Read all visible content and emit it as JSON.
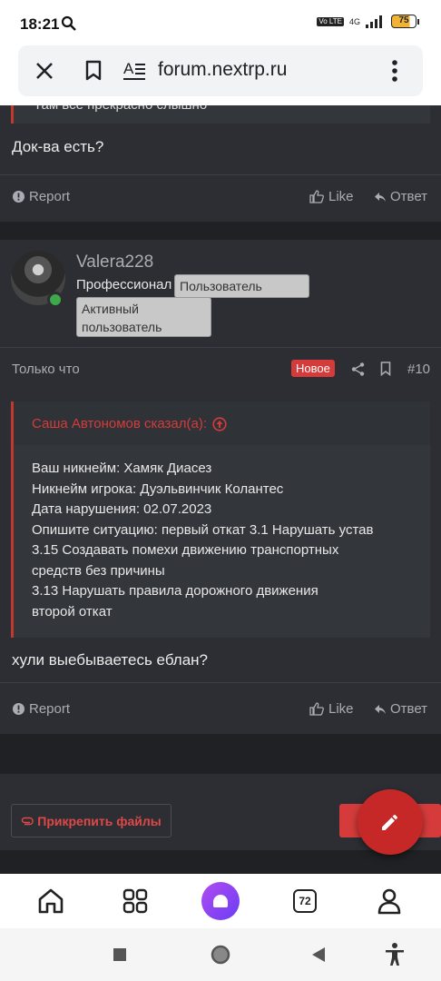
{
  "status": {
    "time": "18:21",
    "volte": "Vo LTE",
    "network": "4G",
    "battery": "75"
  },
  "browser": {
    "url": "forum.nextrp.ru"
  },
  "previous_post": {
    "quote_text_partial": "Там все прекрасно слышно",
    "text": "Док-ва есть?",
    "report_label": "Report",
    "like_label": "Like",
    "reply_label": "Ответ"
  },
  "post": {
    "username": "Valera228",
    "rank": "Профессионал",
    "badges": [
      "Пользователь",
      "Активный пользователь"
    ],
    "time": "Только что",
    "new_label": "Новое",
    "number": "#10",
    "quote": {
      "author": "Саша Автономов сказал(а):",
      "lines": [
        "Ваш никнейм: Хамяк Диасез",
        "Никнейм игрока: Дуэльвинчик Колантес",
        "Дата нарушения: 02.07.2023",
        "Опишите ситуацию: первый откат 3.1 Нарушать устав",
        "3.15 Создавать помехи движению транспортных",
        "средств без причины",
        "3.13 Нарушать правила дорожного движения",
        "второй откат"
      ]
    },
    "text": "хули выебываетесь еблан?",
    "report_label": "Report",
    "like_label": "Like",
    "reply_label": "Ответ"
  },
  "reply_form": {
    "attach_label": "Прикрепить файлы"
  },
  "bottom_nav": {
    "tabs_count": "72"
  },
  "icons": [
    "search-icon",
    "close-icon",
    "bookmark-icon",
    "reader-mode-icon",
    "more-icon",
    "report-icon",
    "like-icon",
    "reply-icon",
    "share-icon",
    "quote-up-icon",
    "paperclip-icon",
    "pencil-icon",
    "home-icon",
    "grid-icon",
    "user-icon",
    "accessibility-icon"
  ]
}
